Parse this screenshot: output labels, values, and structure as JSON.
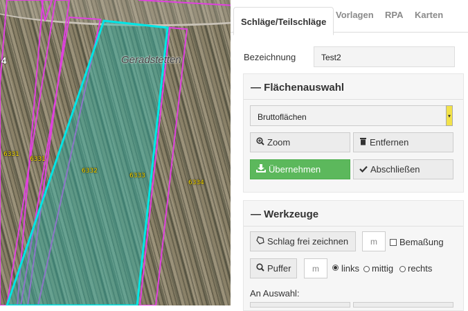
{
  "map": {
    "place_name": "Geradstetten",
    "edge_number": "4",
    "plots": [
      "6331",
      "6331",
      "6332",
      "6333",
      "6334"
    ]
  },
  "tabs": [
    {
      "label": "Schläge/Teilschläge",
      "active": true
    },
    {
      "label": "Vorlagen"
    },
    {
      "label": "RPA"
    },
    {
      "label": "Karten"
    }
  ],
  "bezeichnung": {
    "label": "Bezeichnung",
    "value": "Test2"
  },
  "flaechenauswahl": {
    "title": "Flächenauswahl",
    "collapse_symbol": "—",
    "select_value": "Bruttoflächen",
    "zoom_label": "Zoom",
    "entfernen_label": "Entfernen",
    "uebernehmen_label": "Übernehmen",
    "abschliessen_label": "Abschließen"
  },
  "werkzeuge": {
    "title": "Werkzeuge",
    "collapse_symbol": "—",
    "draw_label": "Schlag frei zeichnen",
    "unit_m": "m",
    "bemassung_label": "Bemaßung",
    "puffer_label": "Puffer",
    "unit_m2": "m",
    "links_label": "links",
    "mittig_label": "mittig",
    "rechts_label": "rechts",
    "an_auswahl_label": "An Auswahl:"
  },
  "colors": {
    "accent_green": "#5cb85c",
    "selected_plot": "#00e5e5",
    "plot_border": "#e040e0"
  }
}
